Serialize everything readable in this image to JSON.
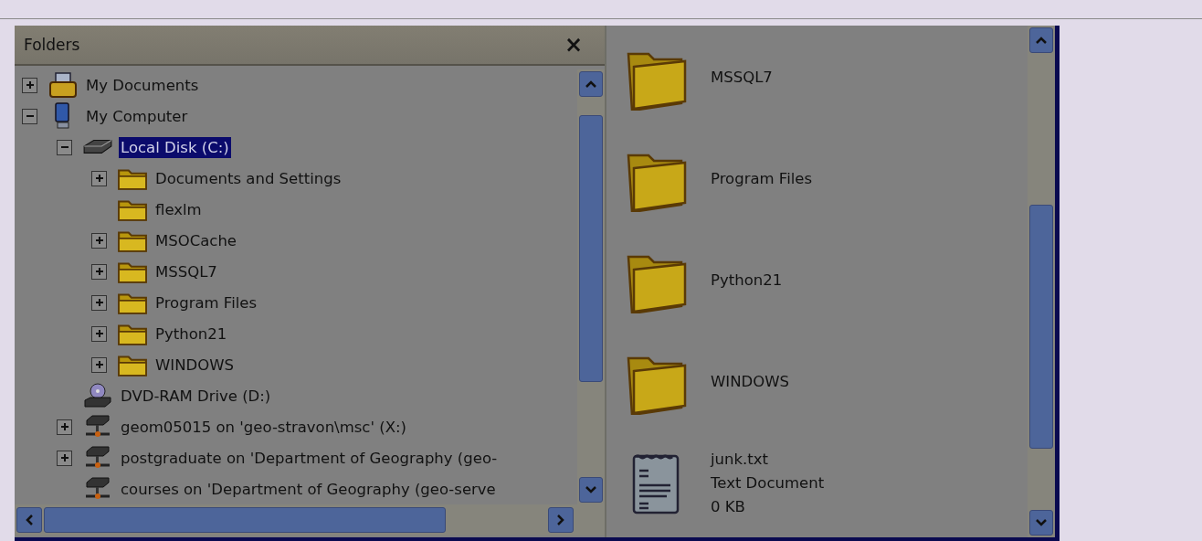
{
  "folders_pane": {
    "title": "Folders",
    "close": "×"
  },
  "tree": [
    {
      "label": "My Documents",
      "kind": "documents",
      "expanded": false,
      "selected": false
    },
    {
      "label": "My Computer",
      "kind": "computer",
      "expanded": true,
      "selected": false,
      "children": [
        {
          "label": "Local Disk (C:)",
          "kind": "disk",
          "expanded": true,
          "selected": true,
          "children": [
            {
              "label": "Documents and Settings",
              "kind": "folder",
              "expanded": false,
              "selected": false
            },
            {
              "label": "flexlm",
              "kind": "folder",
              "selected": false
            },
            {
              "label": "MSOCache",
              "kind": "folder",
              "expanded": false,
              "selected": false
            },
            {
              "label": "MSSQL7",
              "kind": "folder",
              "expanded": false,
              "selected": false
            },
            {
              "label": "Program Files",
              "kind": "folder",
              "expanded": false,
              "selected": false
            },
            {
              "label": "Python21",
              "kind": "folder",
              "expanded": false,
              "selected": false
            },
            {
              "label": "WINDOWS",
              "kind": "folder",
              "expanded": false,
              "selected": false
            }
          ]
        },
        {
          "label": "DVD-RAM Drive (D:)",
          "kind": "dvd",
          "selected": false
        },
        {
          "label": "geom05015 on 'geo-stravon\\msc' (X:)",
          "kind": "network",
          "expanded": false,
          "selected": false
        },
        {
          "label": "postgraduate on 'Department of Geography (geo-",
          "kind": "network",
          "expanded": false,
          "selected": false
        },
        {
          "label": "courses on 'Department of Geography (geo-serve",
          "kind": "network",
          "selected": false
        }
      ]
    }
  ],
  "files": [
    {
      "kind": "folder",
      "name": "MSSQL7"
    },
    {
      "kind": "folder",
      "name": "Program Files"
    },
    {
      "kind": "folder",
      "name": "Python21"
    },
    {
      "kind": "folder",
      "name": "WINDOWS"
    },
    {
      "kind": "text",
      "name": "junk.txt",
      "type": "Text Document",
      "size": "0 KB"
    }
  ]
}
